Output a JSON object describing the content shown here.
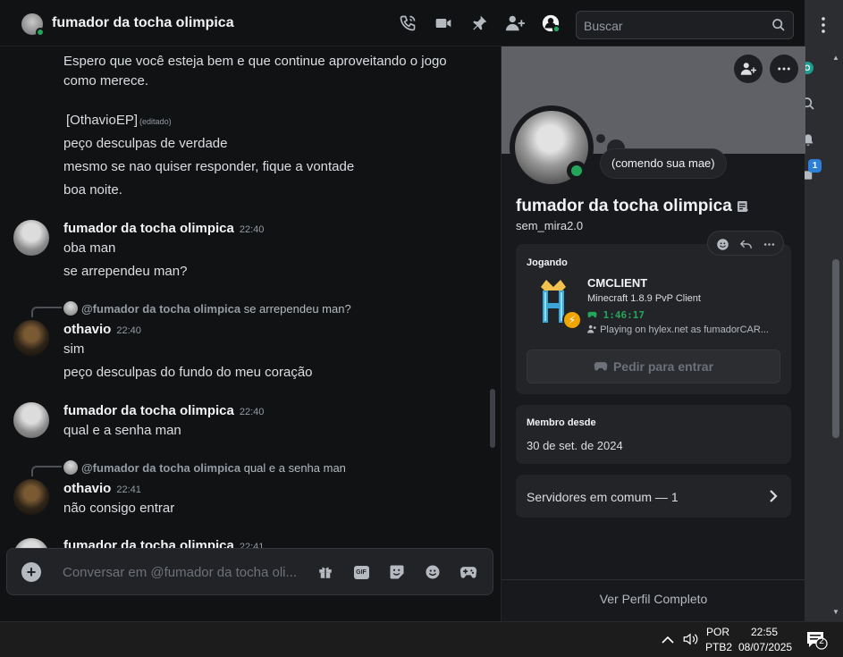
{
  "header": {
    "title": "fumador da tocha olimpica",
    "search_placeholder": "Buscar",
    "icons": [
      "voice-call-icon",
      "video-call-icon",
      "pin-icon",
      "add-friend-icon",
      "profile-toggle-icon",
      "search-icon",
      "more-vertical-icon"
    ]
  },
  "messages": {
    "m1_line1": "Espero que você esteja bem e que continue aproveitando o jogo",
    "m1_line2": "como merece.",
    "m2_line1": "[OthavioEP]",
    "m2_edited": "(editado)",
    "m3": "peço desculpas de verdade",
    "m4": "mesmo se nao quiser responder, fique a vontade",
    "m5": "boa noite.",
    "g1_user": "fumador da tocha olimpica",
    "g1_time": "22:40",
    "g1_l1": "oba man",
    "g1_l2": "se arrependeu man?",
    "g2_reply_user": "@fumador da tocha olimpica",
    "g2_reply_text": "se arrependeu man?",
    "g2_user": "othavio",
    "g2_time": "22:40",
    "g2_l1": "sim",
    "g2_l2": "peço desculpas do fundo do meu coração",
    "g3_user": "fumador da tocha olimpica",
    "g3_time": "22:40",
    "g3_l1": "qual e a senha man",
    "g4_reply_user": "@fumador da tocha olimpica",
    "g4_reply_text": "qual e a senha man",
    "g4_user": "othavio",
    "g4_time": "22:41",
    "g4_l1": "não consigo entrar",
    "g5_user": "fumador da tocha olimpica",
    "g5_time": "22:41"
  },
  "composer": {
    "placeholder": "Conversar em @fumador da tocha oli...",
    "gif_label": "GIF"
  },
  "profile": {
    "custom_status": "(comendo sua mae)",
    "display_name": "fumador da tocha olimpica",
    "username": "sem_mira2.0",
    "activity": {
      "label": "Jogando",
      "name": "CMCLIENT",
      "details": "Minecraft 1.8.9 PvP Client",
      "elapsed": "1:46:17",
      "state": "Playing on hylex.net as fumadorCAR..."
    },
    "join_button": "Pedir para entrar",
    "member_since_label": "Membro desde",
    "member_since_value": "30 de set. de 2024",
    "mutual_servers": "Servidores em comum — 1",
    "view_full": "Ver Perfil Completo",
    "status_color": "#23a55a"
  },
  "sidebar_strip": {
    "notification_badge": "1",
    "online_letter": "O"
  },
  "taskbar": {
    "lang": "POR",
    "layout": "PTB2",
    "time": "22:55",
    "date": "08/07/2025",
    "notifications_count": "2"
  }
}
